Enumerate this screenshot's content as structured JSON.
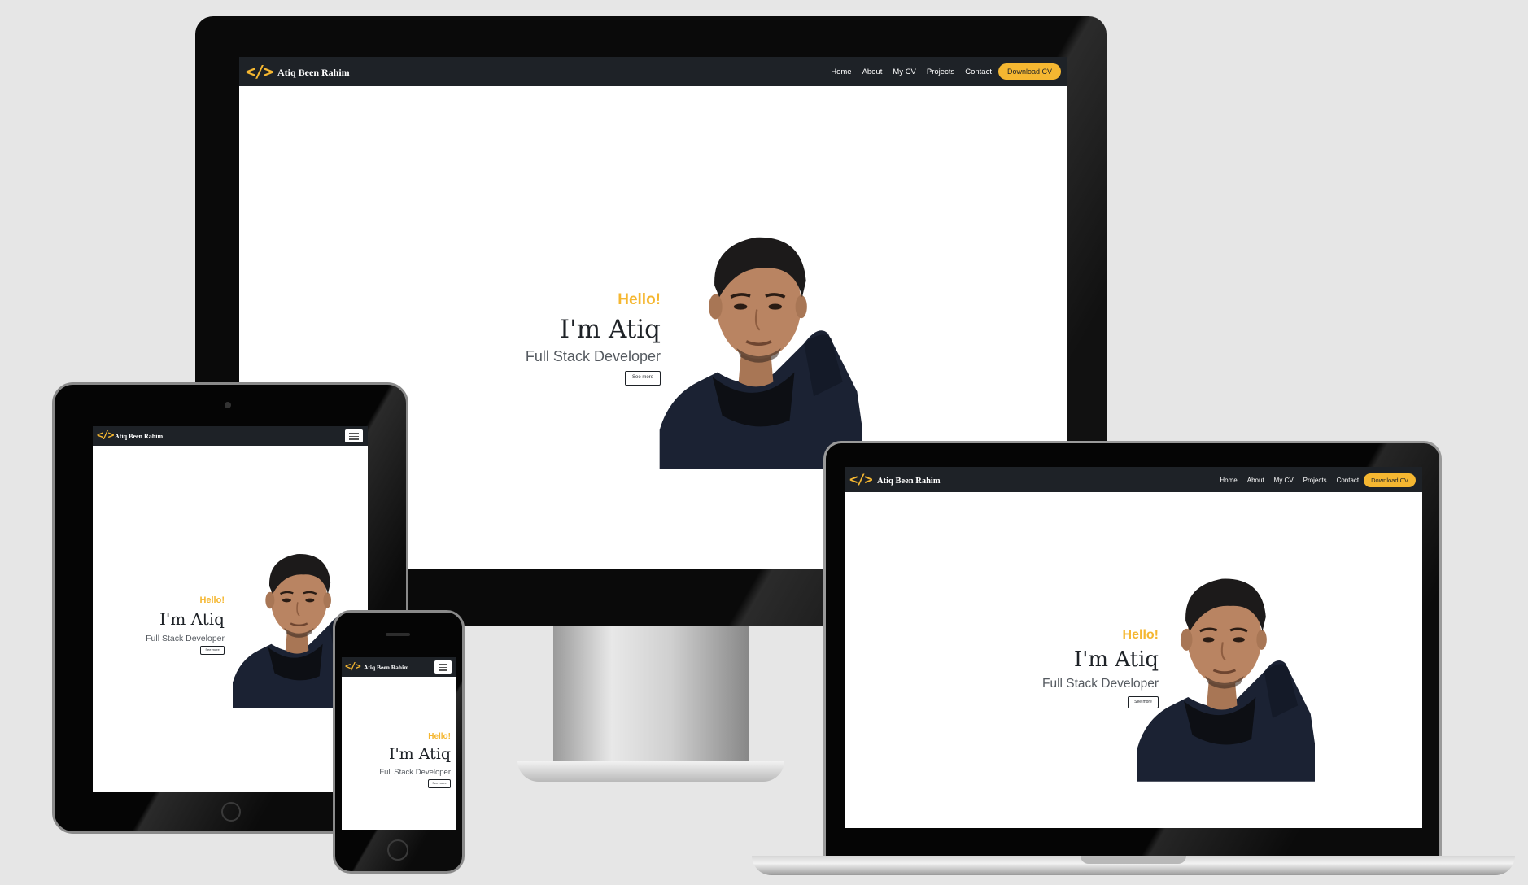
{
  "site": {
    "brand": "Atiq Been Rahim",
    "logo_glyph": "</>",
    "nav": [
      "Home",
      "About",
      "My CV",
      "Projects",
      "Contact"
    ],
    "download_label": "Download CV",
    "hero": {
      "hello": "Hello!",
      "headline": "I'm Atiq",
      "role": "Full Stack Developer",
      "cta": "See more"
    }
  },
  "colors": {
    "accent": "#f5b731",
    "navbar": "#1e2227",
    "background": "#e6e6e6",
    "jacket": "#1b2233",
    "skin": "#b98462",
    "hair": "#1c1a1a"
  },
  "icons": {
    "logo": "code-brackets-icon",
    "menu": "hamburger-menu-icon",
    "home_button": "home-button-icon"
  }
}
